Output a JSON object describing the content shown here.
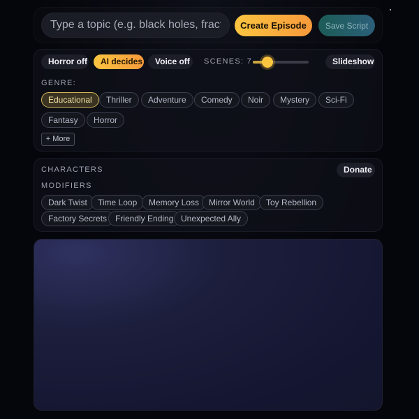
{
  "topbar": {
    "topic_placeholder": "Type a topic (e.g. black holes, fractals)",
    "create_label": "Create Episode",
    "save_label": "Save Script"
  },
  "controls": {
    "horror_toggle": "Horror off",
    "ai_toggle": "AI decides",
    "voice_toggle": "Voice off",
    "scenes_label": "SCENES: 7",
    "scenes_value": 7,
    "slideshow_label": "Slideshow"
  },
  "genre": {
    "label": "GENRE:",
    "selected": "Educational",
    "options": [
      "Educational",
      "Thriller",
      "Adventure",
      "Comedy",
      "Noir",
      "Mystery",
      "Sci-Fi",
      "Fantasy",
      "Horror"
    ],
    "more_label": "+ More"
  },
  "characters": {
    "label": "CHARACTERS",
    "donate_label": "Donate"
  },
  "modifiers": {
    "label": "MODIFIERS",
    "options": [
      "Dark Twist",
      "Time Loop",
      "Memory Loss",
      "Mirror World",
      "Toy Rebellion",
      "Factory Secrets",
      "Friendly Ending",
      "Unexpected Ally"
    ]
  },
  "colors": {
    "accent_gold": "#fbc540",
    "accent_orange": "#f89a3c",
    "teal": "#1c5c57",
    "background": "#05060b"
  }
}
